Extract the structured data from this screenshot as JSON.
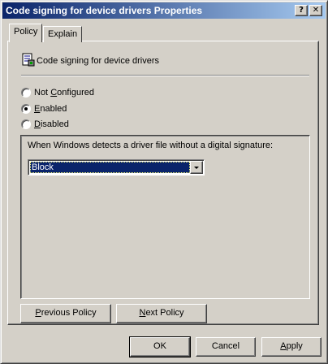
{
  "window": {
    "title": "Code signing for device drivers Properties",
    "help_button": "?",
    "close_button": "✕"
  },
  "tabs": [
    {
      "label": "Policy",
      "active": true
    },
    {
      "label": "Explain",
      "active": false
    }
  ],
  "policy": {
    "icon": "policy-setting-icon",
    "name": "Code signing for device drivers"
  },
  "options": [
    {
      "label_before": "Not ",
      "accel": "C",
      "label_after": "onfigured",
      "checked": false
    },
    {
      "label_before": "",
      "accel": "E",
      "label_after": "nabled",
      "checked": true
    },
    {
      "label_before": "",
      "accel": "D",
      "label_after": "isabled",
      "checked": false
    }
  ],
  "group": {
    "label": "When Windows detects a driver file without a digital signature:",
    "dropdown_value": "Block"
  },
  "nav_buttons": {
    "previous": {
      "accel": "P",
      "rest": "revious Policy"
    },
    "next": {
      "accel": "N",
      "rest": "ext Policy"
    }
  },
  "footer_buttons": {
    "ok": "OK",
    "cancel": "Cancel",
    "apply": {
      "accel": "A",
      "rest": "pply"
    }
  },
  "colors": {
    "title_bar_start": "#0a246a",
    "title_bar_end": "#a6caf0",
    "face": "#d4d0c8",
    "selection": "#0a246a"
  }
}
